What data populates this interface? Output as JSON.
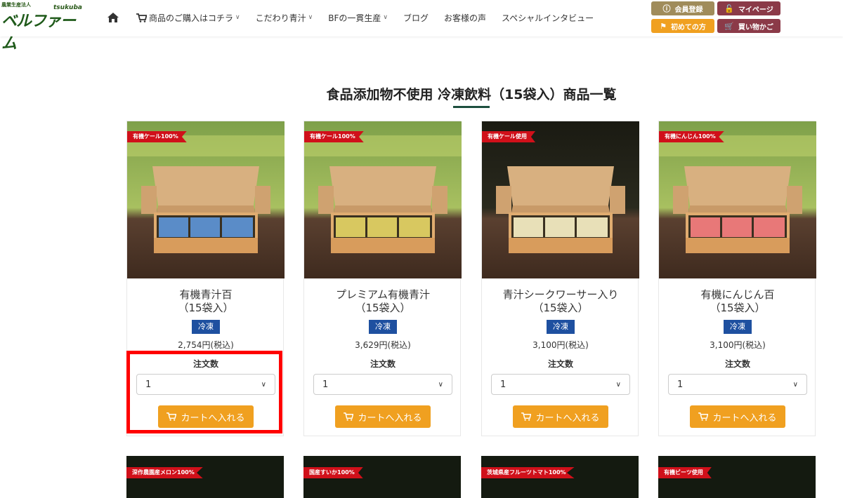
{
  "header": {
    "logo": {
      "corp": "農業生産法人",
      "sub": "tsukuba",
      "main": "ベルファーム"
    },
    "nav": [
      {
        "label": "商品のご購入はコチラ",
        "icon": "cart-icon",
        "dropdown": true
      },
      {
        "label": "こだわり青汁",
        "dropdown": true
      },
      {
        "label": "BFの一貫生産",
        "dropdown": true
      },
      {
        "label": "ブログ",
        "dropdown": false
      },
      {
        "label": "お客様の声",
        "dropdown": false
      },
      {
        "label": "スペシャルインタビュー",
        "dropdown": false
      }
    ],
    "buttons": {
      "register": "会員登録",
      "mypage": "マイページ",
      "first": "初めての方",
      "cart": "買い物かご"
    },
    "colors": {
      "register": "#a08c5b",
      "mypage": "#8b3a48",
      "first": "#f0a020",
      "cart": "#8b3a48"
    }
  },
  "page": {
    "title": "食品添加物不使用 冷凍飲料（15袋入）商品一覧"
  },
  "products": [
    {
      "badge": "有機ケール100%",
      "name1": "有機青汁百",
      "name2": "（15袋入）",
      "category": "冷凍",
      "price": "2,754円(税込)",
      "qty_label": "注文数",
      "qty": "1",
      "cart_label": "カートへ入れる",
      "pack_color": "#5a8cc8",
      "bg": "light"
    },
    {
      "badge": "有機ケール100%",
      "name1": "プレミアム有機青汁",
      "name2": "（15袋入）",
      "category": "冷凍",
      "price": "3,629円(税込)",
      "qty_label": "注文数",
      "qty": "1",
      "cart_label": "カートへ入れる",
      "pack_color": "#d8c860",
      "bg": "light"
    },
    {
      "badge": "有機ケール使用",
      "name1": "青汁シークワーサー入り",
      "name2": "（15袋入）",
      "category": "冷凍",
      "price": "3,100円(税込)",
      "qty_label": "注文数",
      "qty": "1",
      "cart_label": "カートへ入れる",
      "pack_color": "#e8e0b8",
      "bg": "dark"
    },
    {
      "badge": "有機にんじん100%",
      "name1": "有機にんじん百",
      "name2": "（15袋入）",
      "category": "冷凍",
      "price": "3,100円(税込)",
      "qty_label": "注文数",
      "qty": "1",
      "cart_label": "カートへ入れる",
      "pack_color": "#e87878",
      "bg": "light"
    }
  ],
  "products_row2": [
    {
      "badge": "深作農園産メロン100%"
    },
    {
      "badge": "国産すいか100%"
    },
    {
      "badge": "茨城県産フルーツトマト100%"
    },
    {
      "badge": "有機ビーツ使用"
    }
  ],
  "accent_color": "#f0a020",
  "category_color": "#1e50a0",
  "badge_color": "#d0101a"
}
